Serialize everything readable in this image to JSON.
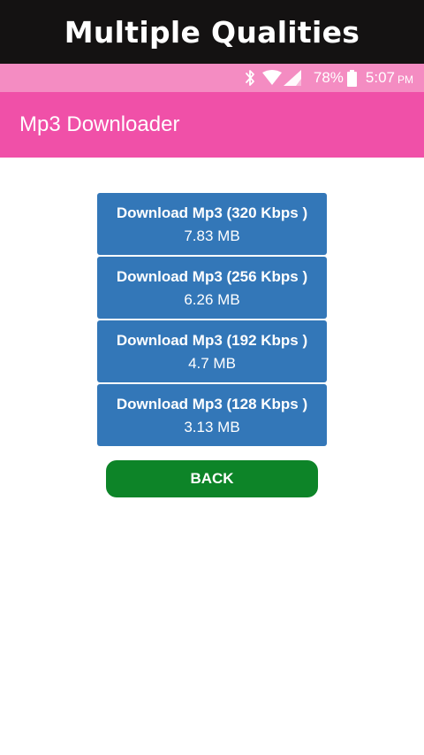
{
  "banner": {
    "title": "Multiple Qualities"
  },
  "status_bar": {
    "icons": [
      "bluetooth-icon",
      "wifi-icon",
      "signal-icon",
      "battery-icon"
    ],
    "battery_percent": "78%",
    "time": "5:07",
    "ampm": "PM"
  },
  "app_bar": {
    "title": "Mp3 Downloader"
  },
  "downloads": [
    {
      "label": "Download Mp3 (320 Kbps )",
      "size": "7.83 MB"
    },
    {
      "label": "Download Mp3 (256 Kbps )",
      "size": "6.26 MB"
    },
    {
      "label": "Download Mp3 (192 Kbps )",
      "size": "4.7 MB"
    },
    {
      "label": "Download Mp3 (128 Kbps )",
      "size": "3.13 MB"
    }
  ],
  "back_button": {
    "label": "BACK"
  },
  "colors": {
    "banner_bg": "#141212",
    "status_bar_bg": "#f48cc2",
    "app_bar_bg": "#f050a8",
    "download_button_bg": "#3377b8",
    "back_button_bg": "#0d8428"
  }
}
